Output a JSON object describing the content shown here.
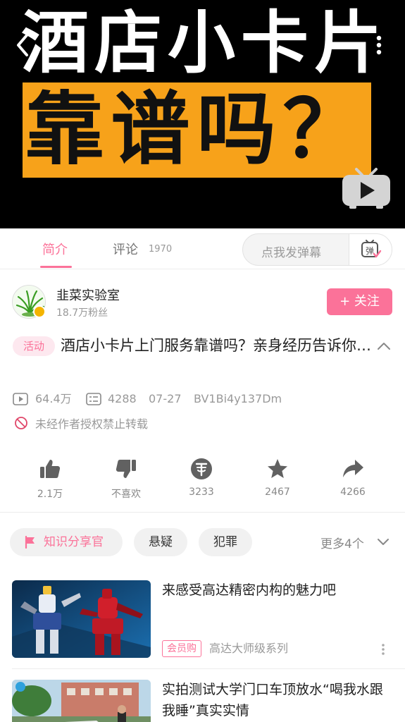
{
  "player": {
    "title_line1": "酒店小卡片",
    "title_line2": "靠谱吗？",
    "icons": {
      "back": "back-chevron-icon",
      "more": "more-vertical-icon",
      "tv": "bilibili-tv-play-icon"
    },
    "colors": {
      "banner": "#f7a21a",
      "background": "#000000"
    }
  },
  "tabs": [
    {
      "label": "简介",
      "active": true
    },
    {
      "label": "评论",
      "count": "1970",
      "active": false
    }
  ],
  "danmu": {
    "placeholder": "点我发弹幕",
    "button_icon": "danmu-toggle-icon",
    "button_glyph": "弹"
  },
  "uploader": {
    "name": "韭菜实验室",
    "fans": "18.7万粉丝",
    "follow_label": "+ 关注"
  },
  "video": {
    "tag": "活动",
    "title": "酒店小卡片上门服务靠谱吗？亲身经历告诉你…",
    "views": "64.4万",
    "danmaku_count": "4288",
    "date": "07-27",
    "bvid": "BV1Bi4y137Dm",
    "copyright": "未经作者授权禁止转载"
  },
  "actions": [
    {
      "icon": "like-icon",
      "label": "2.1万"
    },
    {
      "icon": "dislike-icon",
      "label": "不喜欢"
    },
    {
      "icon": "coin-icon",
      "label": "3233"
    },
    {
      "icon": "favorite-icon",
      "label": "2467"
    },
    {
      "icon": "share-icon",
      "label": "4266"
    }
  ],
  "tags": {
    "featured": "知识分享官",
    "items": [
      "悬疑",
      "犯罪"
    ],
    "more": "更多4个"
  },
  "related": [
    {
      "title": "来感受高达精密内构的魅力吧",
      "tag": "会员购",
      "subtitle": "高达大师级系列"
    },
    {
      "title": "实拍测试大学门口车顶放水“喝我水跟我睡”真实实情"
    }
  ],
  "colors": {
    "accent": "#fb7299",
    "muted": "#999999"
  }
}
